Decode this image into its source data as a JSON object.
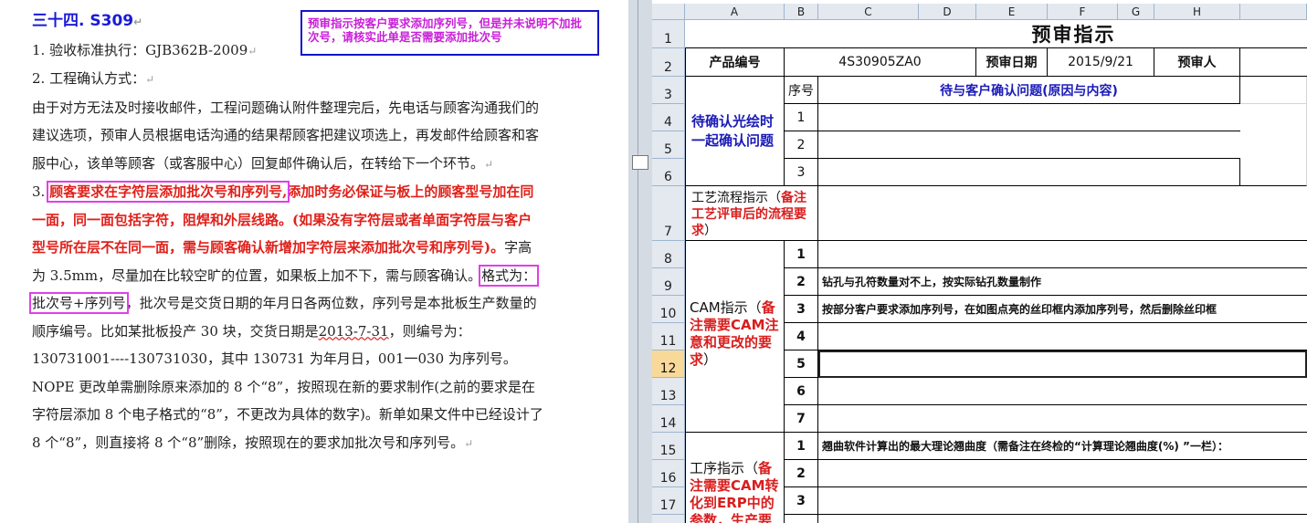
{
  "document": {
    "title": "三十四. S309",
    "note": "预审指示按客户要求添加序列号，但是并未说明不加批次号，请核实此单是否需要添加批次号",
    "p1": "1. 验收标准执行：GJB362B-2009",
    "p2": "2. 工程确认方式：",
    "p3": "由于对方无法及时接收邮件，工程问题确认附件整理完后，先电话与顾客沟通我们的建议选项，预审人员根据电话沟通的结果帮顾客把建议项选上，再发邮件给顾客和客服中心，该单等顾客（或客服中心）回复邮件确认后，在转给下一个环节。",
    "p4_num": "3.",
    "p4_box": "顾客要求在字符层添加批次号和序列号,",
    "p4_red": "添加时务必保证与板上的顾客型号加在同一面，同一面包括字符，阻焊和外层线路。(如果没有字符层或者单面字符层与客户型号所在层不在同一面，需与顾客确认新增加字符层来添加批次号和序列号)。",
    "p4_a": "字高为 3.5mm，尽量加在比较空旷的位置，如果板上加不下，需与顾客确认。",
    "p4_box2": "格式为：批次号+序列号",
    "p4_b": "，批次号是交货日期的年月日各两位数，序列号是本批板生产数量的顺序编号。比如某批板投产 30 块，交货日期是",
    "p4_date": "2013-7-31",
    "p4_c": "，则编号为：130731001----130731030，其中 130731 为年月日，001一030 为序列号。NOPE 更改单需删除原来添加的 8 个“8”，按照现在新的要求制作(之前的要求是在字符层添加 8 个电子格式的“8”，不更改为具体的数字)。新单如果文件中已经设计了 8 个“8”，则直接将 8 个“8”删除，按照现在的要求加批次号和序列号。"
  },
  "sheet": {
    "columns": [
      "A",
      "B",
      "C",
      "D",
      "E",
      "F",
      "G",
      "H"
    ],
    "rows": [
      "1",
      "2",
      "3",
      "4",
      "5",
      "6",
      "7",
      "8",
      "9",
      "10",
      "11",
      "12",
      "13",
      "14",
      "15",
      "16",
      "17"
    ],
    "selected_row": "12",
    "header_title": "预审指示",
    "product_label": "产品编号",
    "product_value": "4S30905ZA0",
    "date_label": "预审日期",
    "date_value": "2015/9/21",
    "reviewer_label": "预审人",
    "seq_label": "序号",
    "issue_header": "待与客户确认问题(原因与内容)",
    "confirm_label": "待确认光绘时一起确认问题",
    "process_label_a": "工艺流程指示（",
    "process_label_b": "备注工艺评审后的流程要求",
    "process_label_c": "）",
    "cam_label_a": "CAM指示（",
    "cam_label_b": "备注需要CAM注意和更改的要求",
    "cam_label_c": "）",
    "op_label_a": "工序指示（",
    "op_label_b": "备注需要CAM转化到ERP中的参数，生产要求",
    "nums": [
      "1",
      "2",
      "3",
      "4",
      "5",
      "6",
      "7"
    ],
    "cam_row2": "钻孔与孔符数量对不上，按实际钻孔数量制作",
    "cam_row3": "按部分客户要求添加序列号，在如图点亮的丝印框内添加序列号，然后删除丝印框",
    "op_row1": "翘曲软件计算出的最大理论翘曲度（需备注在终检的“计算理论翘曲度(%) ”一栏）："
  },
  "colors": {
    "title_blue": "#1a1ad8",
    "note_magenta": "#c81fd8",
    "emphasis_red": "#e0201a",
    "box_pink": "#e040e8"
  }
}
